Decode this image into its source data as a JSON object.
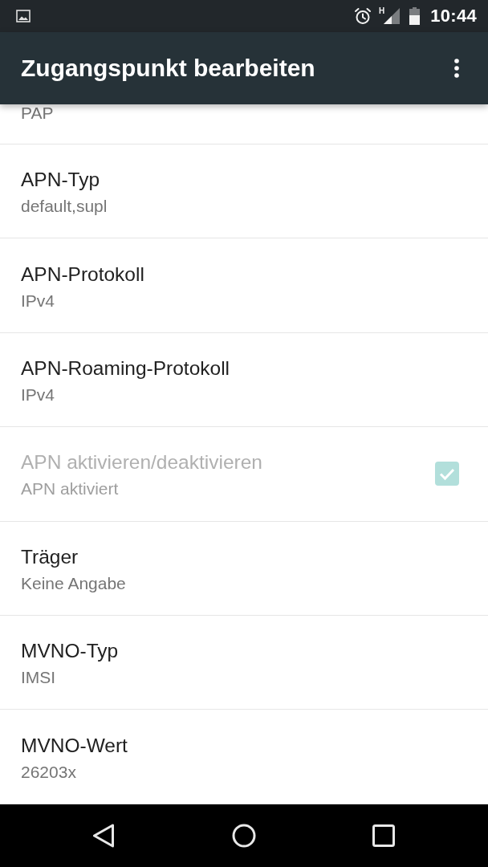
{
  "status_bar": {
    "network_type": "H",
    "time": "10:44"
  },
  "app_bar": {
    "title": "Zugangspunkt bearbeiten"
  },
  "items": [
    {
      "kind": "text",
      "summary": "PAP",
      "disabled": false
    },
    {
      "kind": "text",
      "title": "APN-Typ",
      "summary": "default,supl",
      "disabled": false
    },
    {
      "kind": "text",
      "title": "APN-Protokoll",
      "summary": "IPv4",
      "disabled": false
    },
    {
      "kind": "text",
      "title": "APN-Roaming-Protokoll",
      "summary": "IPv4",
      "disabled": false
    },
    {
      "kind": "checkbox",
      "title": "APN aktivieren/deaktivieren",
      "summary": "APN aktiviert",
      "disabled": true,
      "checked": true
    },
    {
      "kind": "text",
      "title": "Träger",
      "summary": "Keine Angabe",
      "disabled": false
    },
    {
      "kind": "text",
      "title": "MVNO-Typ",
      "summary": "IMSI",
      "disabled": false
    },
    {
      "kind": "text",
      "title": "MVNO-Wert",
      "summary": "26203x",
      "disabled": false
    }
  ]
}
